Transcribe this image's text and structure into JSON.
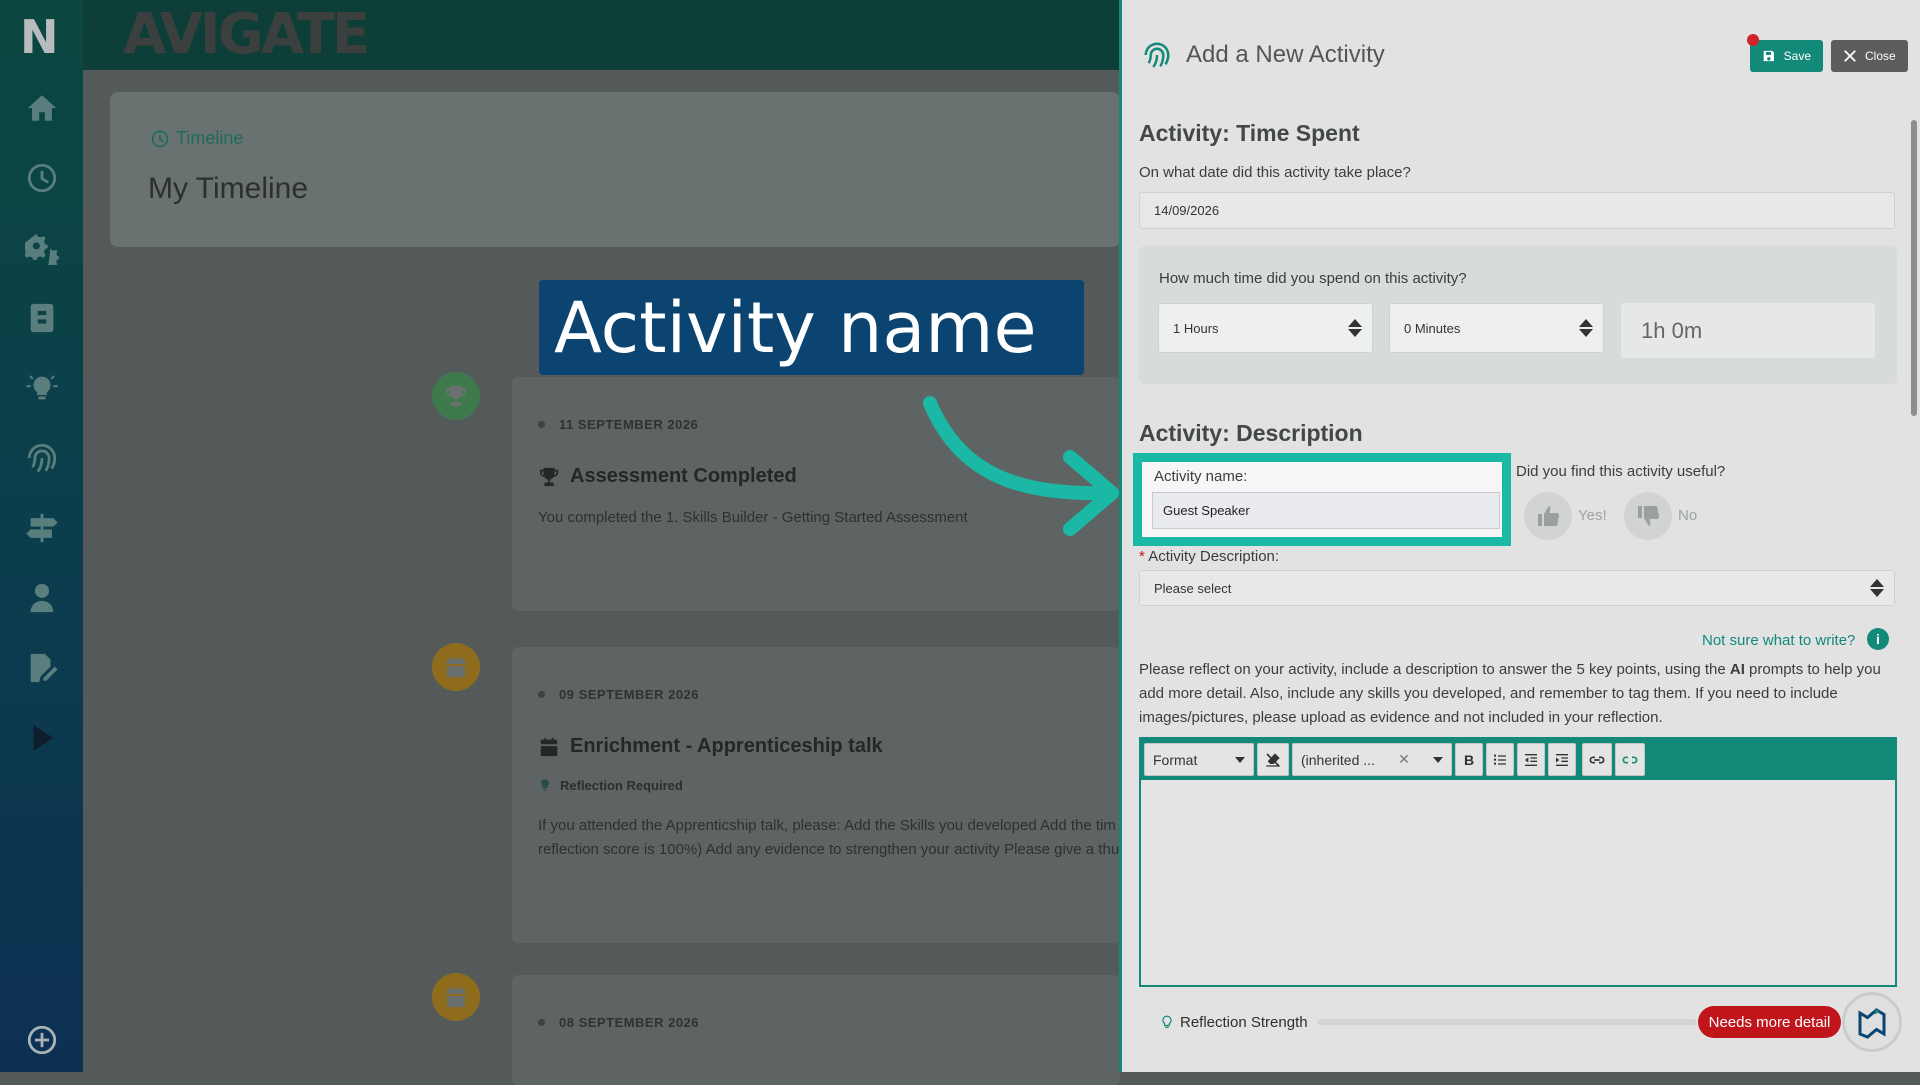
{
  "brand": {
    "logo_letter": "N",
    "name": "AVIGATE"
  },
  "sidebar": {
    "icons": [
      "home-icon",
      "clock-icon",
      "gears-icon",
      "clipboard-icon",
      "lightbulb-icon",
      "fingerprint-icon",
      "signpost-icon",
      "user-icon",
      "edit-icon",
      "play-icon",
      "add-icon"
    ]
  },
  "timeline": {
    "link": "Timeline",
    "title": "My Timeline",
    "items": [
      {
        "date": "11 SEPTEMBER 2026",
        "title": "Assessment Completed",
        "text": "You completed the 1. Skills Builder - Getting Started Assessment",
        "icon": "trophy-icon",
        "color": "#3f7a4c"
      },
      {
        "date": "09 SEPTEMBER 2026",
        "title": "Enrichment - Apprenticeship talk",
        "tag": "Reflection Required",
        "text1": "If you attended the Apprenticship talk, please: Add the Skills you developed Add the tim",
        "text2": "reflection score is 100%) Add any evidence to strengthen your activity Please give a thu",
        "icon": "calendar-icon",
        "color": "#8e6c1c"
      },
      {
        "date": "08 SEPTEMBER 2026",
        "icon": "calendar-icon",
        "color": "#8e6c1c"
      }
    ]
  },
  "callout": {
    "text": "Activity name"
  },
  "panel": {
    "title": "Add a New Activity",
    "save_label": "Save",
    "close_label": "Close",
    "section_time": "Activity: Time Spent",
    "date_question": "On what date did this activity take place?",
    "date_value": "14/09/2026",
    "time_question": "How much time did you spend on this activity?",
    "hours_value": "1 Hours",
    "minutes_value": "0 Minutes",
    "total_time": "1h 0m",
    "section_desc": "Activity: Description",
    "activity_name_label": "Activity name:",
    "activity_name_value": "Guest Speaker",
    "useful_question": "Did you find this activity useful?",
    "yes_label": "Yes!",
    "no_label": "No",
    "desc_label": "Activity Description:",
    "desc_required": "*",
    "desc_value": "Please select",
    "help_link": "Not sure what to write?",
    "instructions_a": "Please reflect on your activity, include a description to answer the 5 key points, using the ",
    "instructions_ai": "AI",
    "instructions_b": " prompts to help you add more detail. Also, include any skills you developed, and remember to tag them. If you need to include images/pictures, please upload as evidence and not included in your reflection.",
    "editor": {
      "format_label": "Format",
      "font_label": "(inherited ...",
      "bold_label": "B"
    },
    "reflection_label": "Reflection Strength",
    "reflection_level": 0,
    "reflection_badge": "Needs more detail"
  },
  "colors": {
    "accent": "#13897a",
    "highlight": "#1bb8a6",
    "callout_bg": "#0b4470",
    "danger": "#c1151c"
  }
}
